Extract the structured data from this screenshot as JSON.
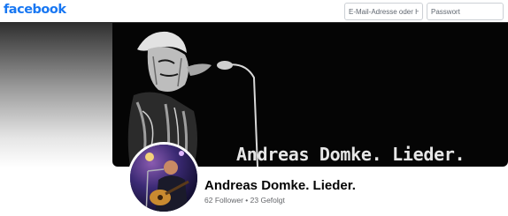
{
  "header": {
    "logo_text": "facebook",
    "email_placeholder": "E-Mail-Adresse oder Ha",
    "password_placeholder": "Passwort"
  },
  "cover": {
    "text": "Andreas Domke. Lieder."
  },
  "profile": {
    "name": "Andreas Domke. Lieder.",
    "stats": "62 Follower • 23 Gefolgt"
  },
  "colors": {
    "brand": "#1877f2",
    "name_text": "#050505",
    "secondary_text": "#65676b"
  }
}
